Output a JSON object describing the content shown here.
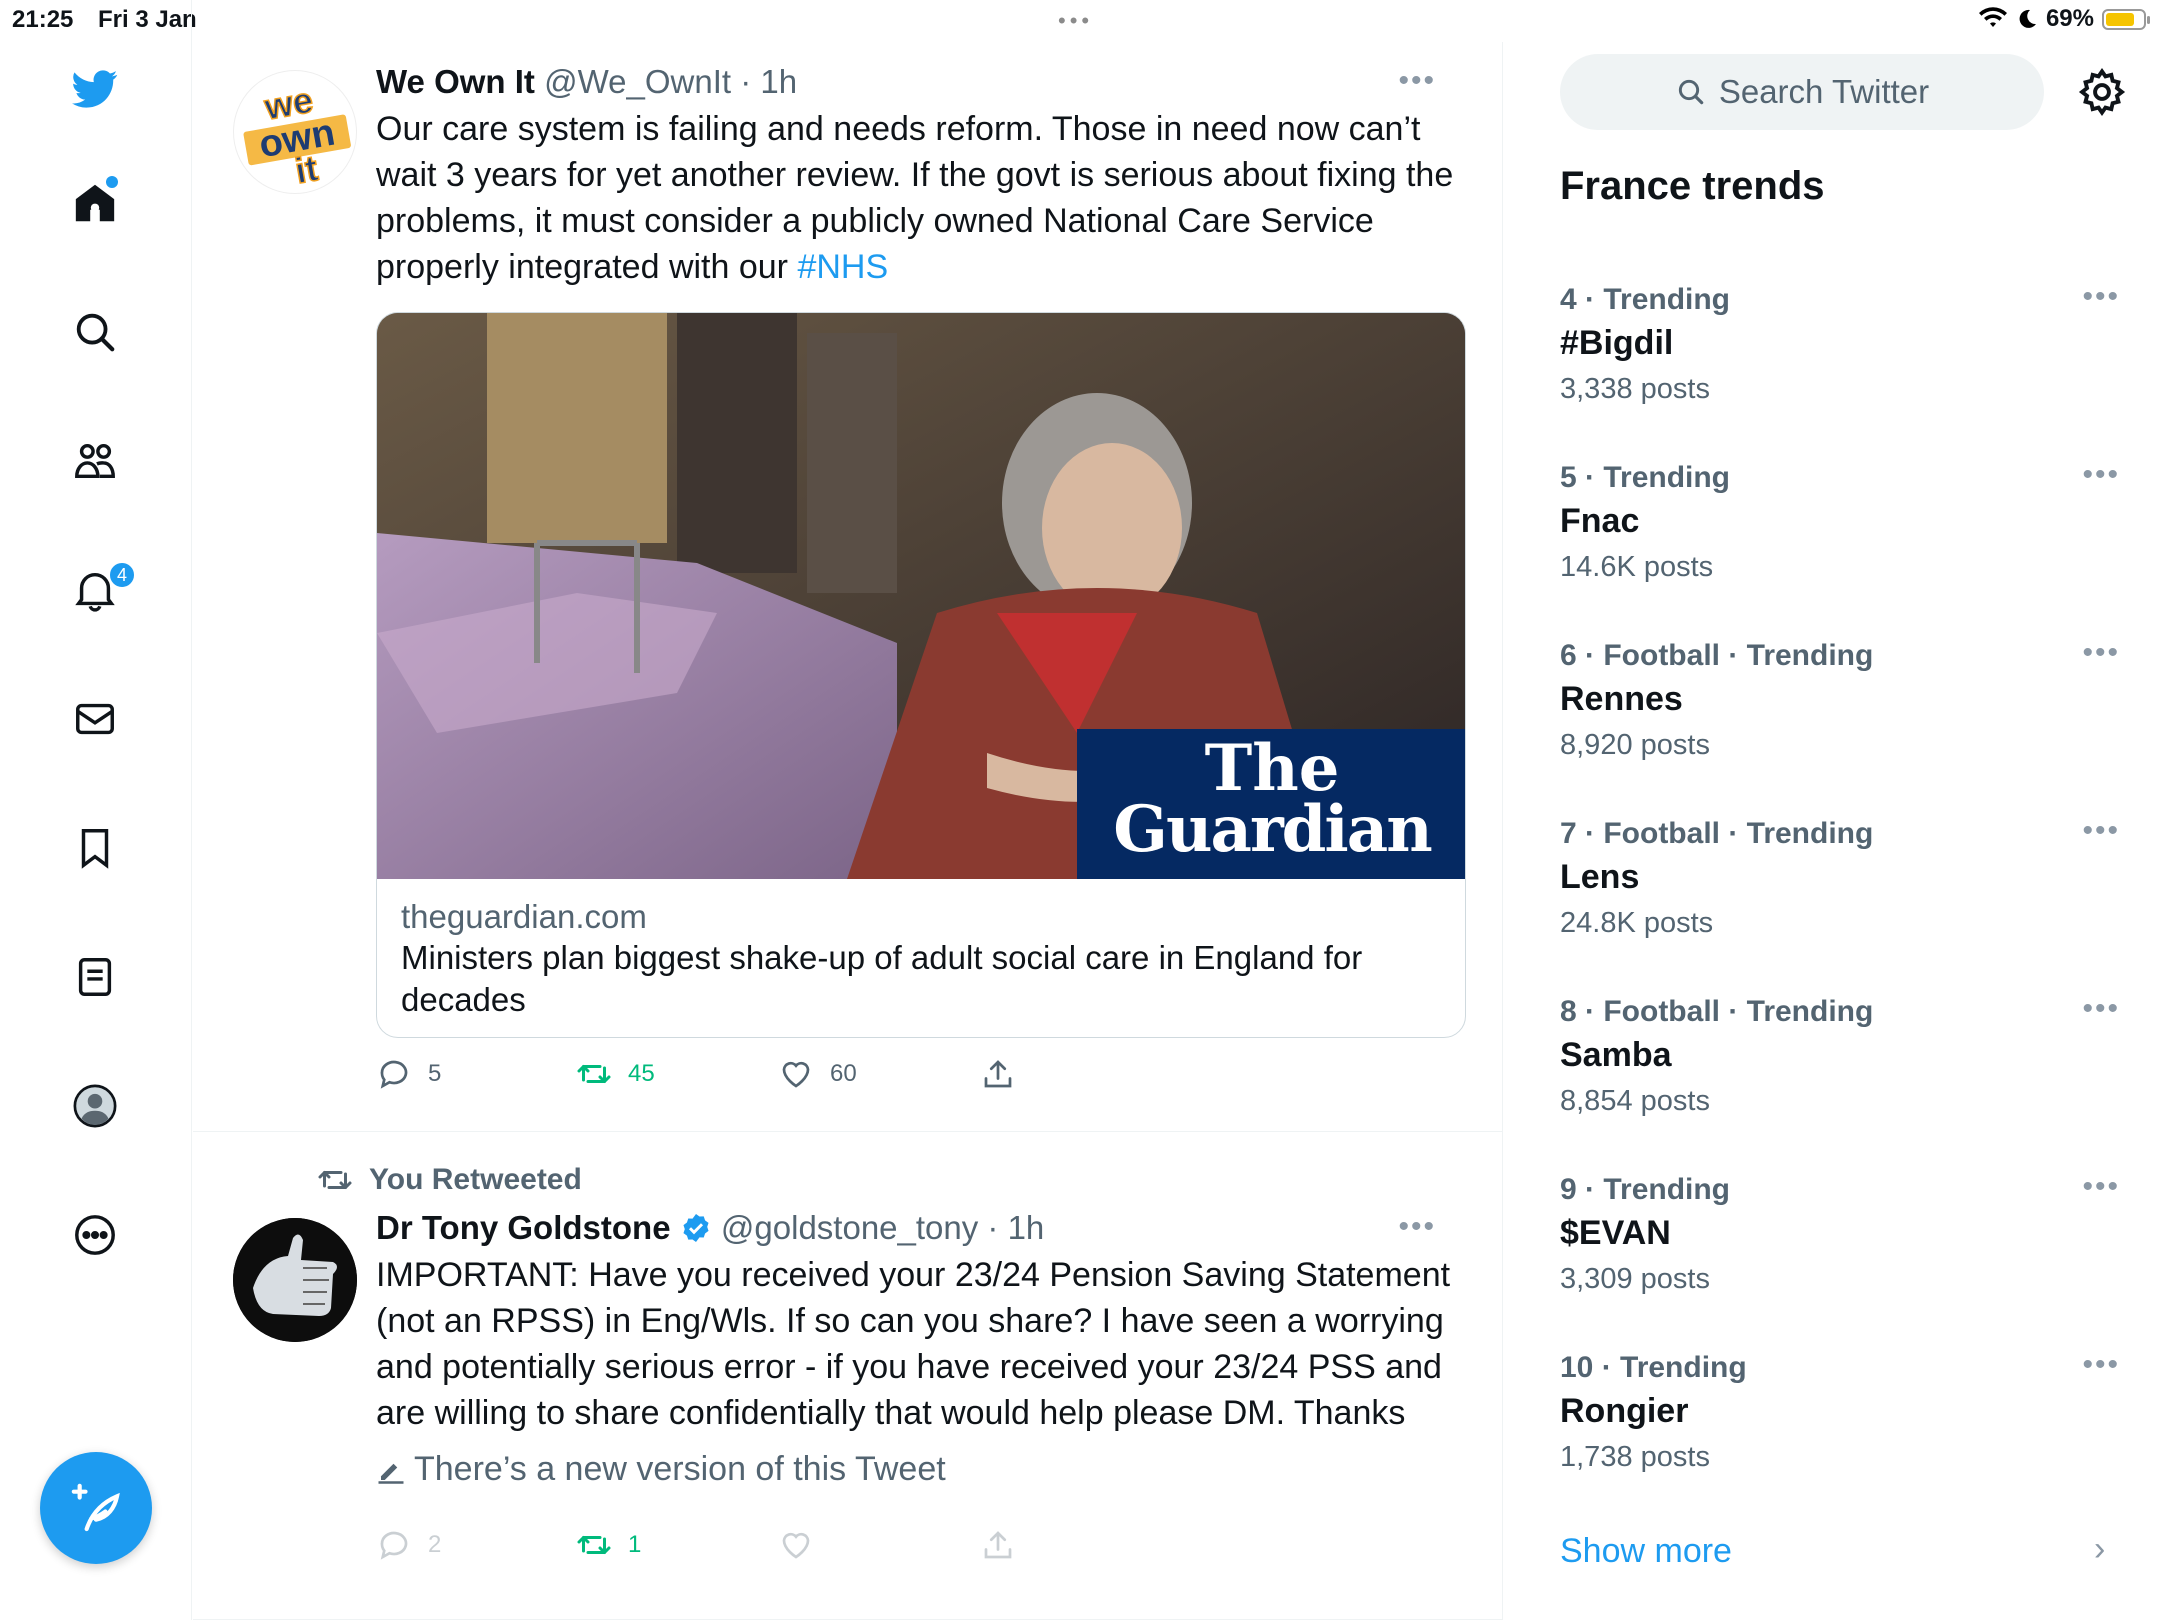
{
  "status_bar": {
    "time": "21:25",
    "date": "Fri 3 Jan",
    "battery": "69%",
    "battery_level": 0.69
  },
  "nav": {
    "notifications_badge": "4"
  },
  "search": {
    "placeholder": "Search Twitter"
  },
  "trends": {
    "title": "France trends",
    "items": [
      {
        "context": "4 · Trending",
        "topic": "#Bigdil",
        "count": "3,338 posts"
      },
      {
        "context": "5 · Trending",
        "topic": "Fnac",
        "count": "14.6K posts"
      },
      {
        "context": "6 · Football · Trending",
        "topic": "Rennes",
        "count": "8,920 posts"
      },
      {
        "context": "7 · Football · Trending",
        "topic": "Lens",
        "count": "24.8K posts"
      },
      {
        "context": "8 · Football · Trending",
        "topic": "Samba",
        "count": "8,854 posts"
      },
      {
        "context": "9 · Trending",
        "topic": "$EVAN",
        "count": "3,309 posts"
      },
      {
        "context": "10 · Trending",
        "topic": "Rongier",
        "count": "1,738 posts"
      }
    ],
    "show_more": "Show more"
  },
  "tweets": [
    {
      "name": "We Own It",
      "meta": "@We_OwnIt · 1h",
      "avatar_text": [
        "we",
        "own",
        "it"
      ],
      "text": "Our care system is failing and needs reform. Those in need now can’t wait 3 years for yet another review. If the govt is serious about fixing the problems, it must consider a publicly owned National  Care Service properly integrated with our ",
      "hashtag": "#NHS",
      "card": {
        "brand_line1": "The",
        "brand_line2": "Guardian",
        "domain": "theguardian.com",
        "title": "Ministers plan biggest shake-up of adult social care in England for decades"
      },
      "replies": "5",
      "retweets": "45",
      "likes": "60"
    },
    {
      "retweet_label": "You Retweeted",
      "name": "Dr Tony Goldstone",
      "meta": "@goldstone_tony · 1h",
      "text": "IMPORTANT: Have you received your 23/24 Pension Saving Statement (not an RPSS) in Eng/Wls. If so can you share? I have seen a worrying and potentially serious error - if you have received your 23/24 PSS and are willing to share confidentially that would help please DM. Thanks",
      "edit_notice": "There’s a new version of this Tweet",
      "replies": "2",
      "retweets": "1"
    }
  ],
  "colors": {
    "accent": "#1d9bf0",
    "retweet_green": "#00ba7c",
    "muted": "#536471",
    "guardian_blue": "#052962"
  }
}
